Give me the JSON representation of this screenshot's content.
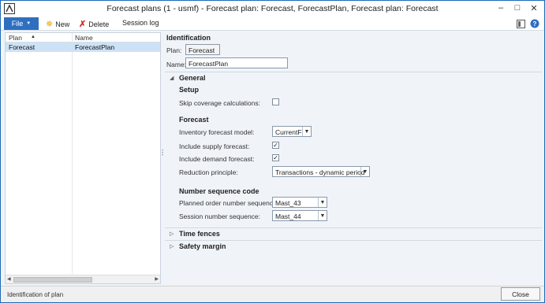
{
  "window": {
    "title": "Forecast plans (1 - usmf) - Forecast plan: Forecast, ForecastPlan, Forecast plan: Forecast"
  },
  "toolbar": {
    "file_label": "File",
    "new_label": "New",
    "delete_label": "Delete",
    "session_log_label": "Session log"
  },
  "grid": {
    "columns": [
      "Plan",
      "Name"
    ],
    "rows": [
      {
        "plan": "Forecast",
        "name": "ForecastPlan"
      }
    ],
    "sort_column": "Plan"
  },
  "identification": {
    "title": "Identification",
    "plan_label": "Plan:",
    "plan_value": "Forecast",
    "name_label": "Name:",
    "name_value": "ForecastPlan"
  },
  "general": {
    "title": "General",
    "setup_title": "Setup",
    "skip_coverage_label": "Skip coverage calculations:",
    "skip_coverage_checked": false,
    "forecast_title": "Forecast",
    "inventory_model_label": "Inventory forecast model:",
    "inventory_model_value": "CurrentF",
    "include_supply_label": "Include supply forecast:",
    "include_supply_checked": true,
    "include_demand_label": "Include demand forecast:",
    "include_demand_checked": true,
    "reduction_label": "Reduction principle:",
    "reduction_value": "Transactions - dynamic period",
    "number_seq_title": "Number sequence code",
    "planned_order_label": "Planned order number sequence:",
    "planned_order_value": "Mast_43",
    "session_seq_label": "Session number sequence:",
    "session_seq_value": "Mast_44"
  },
  "fasttabs": {
    "time_fences": "Time fences",
    "safety_margin": "Safety margin"
  },
  "status": {
    "text": "Identification of plan",
    "close_label": "Close"
  },
  "colors": {
    "accent": "#2f6fc0",
    "selected_row": "#cde2f6",
    "frame": "#1f6bb5"
  }
}
